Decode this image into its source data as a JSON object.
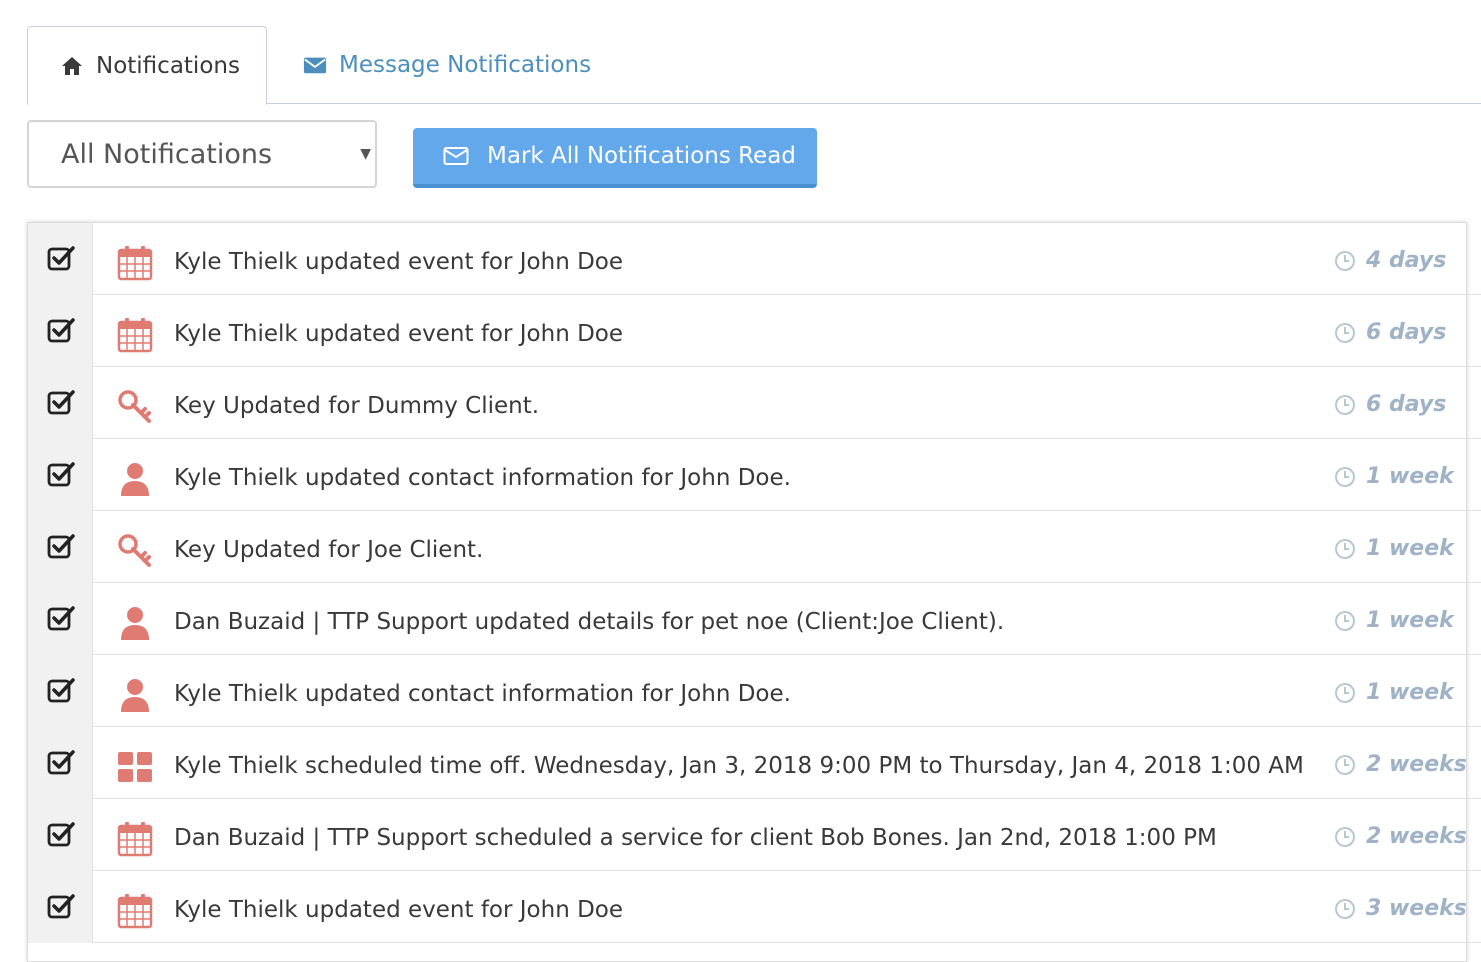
{
  "tabs": [
    {
      "label": "Notifications",
      "icon": "home-icon",
      "active": true
    },
    {
      "label": "Message Notifications",
      "icon": "envelope-icon",
      "active": false
    }
  ],
  "filter": {
    "selected": "All Notifications"
  },
  "mark_all_button": {
    "label": "Mark All Notifications Read",
    "icon": "envelope-outline-icon"
  },
  "colors": {
    "accent": "#62a8ea",
    "icon": "#e07b74",
    "time": "#9fb2c6",
    "tab_link": "#4c8fbd"
  },
  "notifications": [
    {
      "icon": "calendar-icon",
      "text": "Kyle Thielk updated event for John Doe",
      "time": "4 days"
    },
    {
      "icon": "calendar-icon",
      "text": "Kyle Thielk updated event for John Doe",
      "time": "6 days"
    },
    {
      "icon": "key-icon",
      "text": "Key Updated for Dummy Client.",
      "time": "6 days"
    },
    {
      "icon": "user-icon",
      "text": "Kyle Thielk updated contact information for John Doe.",
      "time": "1 week"
    },
    {
      "icon": "key-icon",
      "text": "Key Updated for Joe Client.",
      "time": "1 week"
    },
    {
      "icon": "user-icon",
      "text": "Dan Buzaid | TTP Support updated details for pet noe (Client:Joe Client).",
      "time": "1 week"
    },
    {
      "icon": "user-icon",
      "text": "Kyle Thielk updated contact information for John Doe.",
      "time": "1 week"
    },
    {
      "icon": "grid-icon",
      "text": "Kyle Thielk scheduled time off. Wednesday, Jan 3, 2018 9:00 PM to Thursday, Jan 4, 2018 1:00 AM",
      "time": "2 weeks"
    },
    {
      "icon": "calendar-icon",
      "text": "Dan Buzaid | TTP Support scheduled a service for client Bob Bones. Jan 2nd, 2018 1:00 PM",
      "time": "2 weeks"
    },
    {
      "icon": "calendar-icon",
      "text": "Kyle Thielk updated event for John Doe",
      "time": "3 weeks"
    }
  ]
}
